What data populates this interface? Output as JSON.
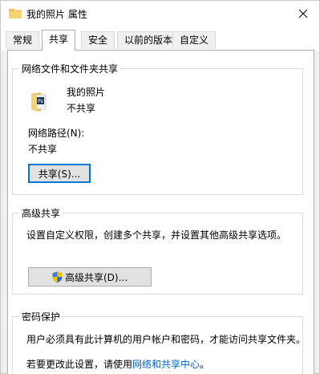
{
  "window": {
    "title": "我的照片 属性"
  },
  "tabs": [
    {
      "label": "常规"
    },
    {
      "label": "共享"
    },
    {
      "label": "安全"
    },
    {
      "label": "以前的版本"
    },
    {
      "label": "自定义"
    }
  ],
  "network_sharing": {
    "legend": "网络文件和文件夹共享",
    "folder_name": "我的照片",
    "share_status": "不共享",
    "path_label": "网络路径(N):",
    "path_value": "不共享",
    "share_button": "共享(S)..."
  },
  "advanced_sharing": {
    "legend": "高级共享",
    "description": "设置自定义权限，创建多个共享，并设置其他高级共享选项。",
    "button": "高级共享(D)..."
  },
  "password_protection": {
    "legend": "密码保护",
    "description": "用户必须具有此计算机的用户帐户和密码，才能访问共享文件夹。",
    "change_prefix": "若要更改此设置，请使用",
    "link": "网络和共享中心",
    "change_suffix": "。"
  },
  "colors": {
    "link": "#0066cc",
    "focus_border": "#0078d7",
    "folder": "#e8c15c"
  },
  "icons": [
    "folder-icon",
    "close-icon",
    "shield-icon"
  ]
}
